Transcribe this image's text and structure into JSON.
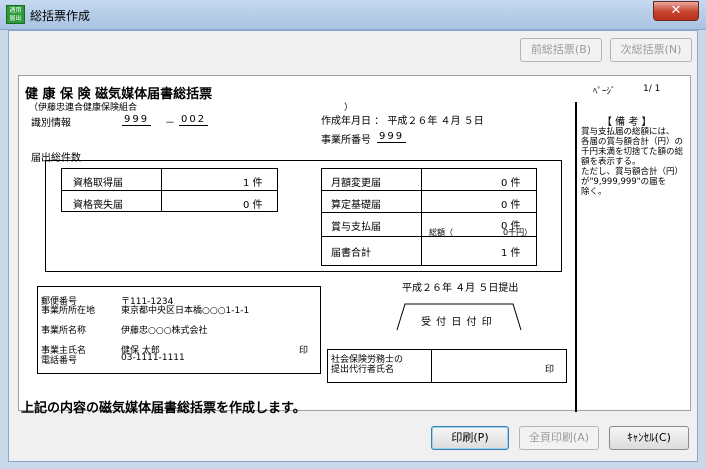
{
  "window": {
    "title": "総括票作成",
    "icon_text_1": "適用",
    "icon_text_2": "届出",
    "close": "✕"
  },
  "toolbar": {
    "prev": "前総括票(B)",
    "next": "次総括票(N)"
  },
  "report": {
    "page_label": "ﾍﾟｰｼﾞ",
    "page_value": "1/  1",
    "title": "健 康 保 険   磁気媒体届書総括票",
    "union": "（伊藤忠連合健康保険組合",
    "union_close": "）",
    "id_label": "識別情報",
    "id_part1": "999",
    "id_dash": "－",
    "id_part2": "002",
    "created_label": "作成年月日 ： 平成２６年  ４月  ５日",
    "office_no_label": "事業所番号",
    "office_no": "999",
    "total_label": "届出総件数",
    "items_left": [
      {
        "label": "資格取得届",
        "value": "1  件"
      },
      {
        "label": "資格喪失届",
        "value": "0  件"
      }
    ],
    "items_right": [
      {
        "label": "月額変更届",
        "value": "0  件"
      },
      {
        "label": "算定基礎届",
        "value": "0  件"
      },
      {
        "label": "賞与支払届",
        "value": "0  件"
      }
    ],
    "bonus_total_label": "総額（",
    "bonus_total_value": "0千円）",
    "sum_label": "届書合計",
    "sum_value": "1  件",
    "submit_date": "平成２６年  ４月  ５日提出",
    "postal_label": "郵便番号",
    "postal_value": "〒111-1234",
    "address_label": "事業所所在地",
    "address_value": "東京都中央区日本橋○○○1-1-1",
    "name_label": "事業所名称",
    "name_value": "伊藤忠○○○株式会社",
    "owner_label": "事業主氏名",
    "owner_value": "健保  太郎",
    "phone_label": "電話番号",
    "phone_value": "03-1111-1111",
    "seal": "印",
    "reception_label": "受 付 日 付 印",
    "agent_label_1": "社会保険労務士の",
    "agent_label_2": "提出代行者氏名",
    "agent_seal": "印",
    "remarks_title": "【 備 考 】",
    "remarks_lines": [
      "  賞与支払届の総額には、",
      "各届の賞与額合計（円）の",
      "千円未満を切捨てた額の総",
      "額を表示する。",
      "  ただし、賞与額合計（円）",
      "が\"9,999,999\"の届を",
      "除く。"
    ]
  },
  "message": "上記の内容の磁気媒体届書総括票を作成します。",
  "buttons": {
    "print": "印刷(P)",
    "print_all": "全頁印刷(A)",
    "cancel": "ｷｬﾝｾﾙ(C)"
  }
}
